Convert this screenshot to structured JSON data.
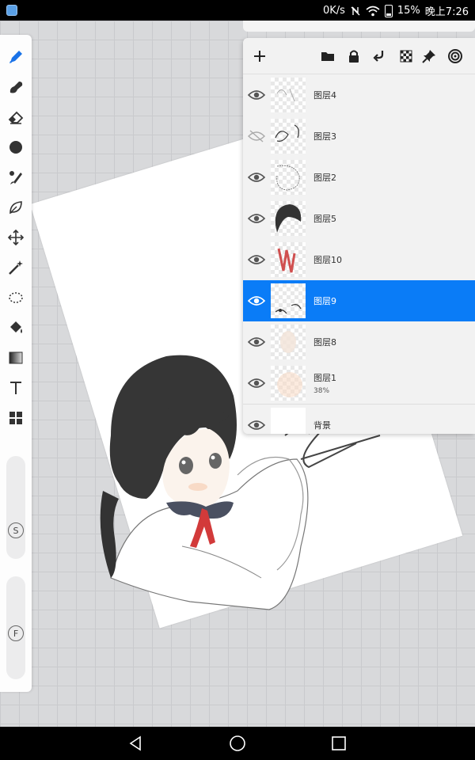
{
  "status_bar": {
    "net_speed": "0K/s",
    "battery": "15%",
    "time": "晚上7:26"
  },
  "toolbar": {
    "tools": [
      "brush-tool",
      "smudge-tool",
      "eraser-tool",
      "color-circle",
      "brush-library",
      "leaf-tool",
      "transform-tool",
      "magic-wand",
      "lasso-select",
      "fill-bucket",
      "gradient-tool",
      "text-tool",
      "layout-tool"
    ],
    "size_slider_label": "S",
    "flow_slider_label": "F"
  },
  "layers_panel": {
    "header_icons": [
      "add-icon",
      "folder-icon",
      "lock-icon",
      "merge-down-icon",
      "checkerboard-icon",
      "pin-icon",
      "target-icon"
    ],
    "layers": [
      {
        "name": "图层4",
        "visible": true,
        "selected": false,
        "opacity": ""
      },
      {
        "name": "图层3",
        "visible": false,
        "selected": false,
        "opacity": ""
      },
      {
        "name": "图层2",
        "visible": true,
        "selected": false,
        "opacity": ""
      },
      {
        "name": "图层5",
        "visible": true,
        "selected": false,
        "opacity": ""
      },
      {
        "name": "图层10",
        "visible": true,
        "selected": false,
        "opacity": ""
      },
      {
        "name": "图层9",
        "visible": true,
        "selected": true,
        "opacity": ""
      },
      {
        "name": "图层8",
        "visible": true,
        "selected": false,
        "opacity": ""
      },
      {
        "name": "图层1",
        "visible": true,
        "selected": false,
        "opacity": "38%"
      },
      {
        "name": "背景",
        "visible": true,
        "selected": false,
        "opacity": ""
      }
    ]
  },
  "colors": {
    "accent": "#0a7cf7",
    "active_tool": "#1a73e8"
  }
}
